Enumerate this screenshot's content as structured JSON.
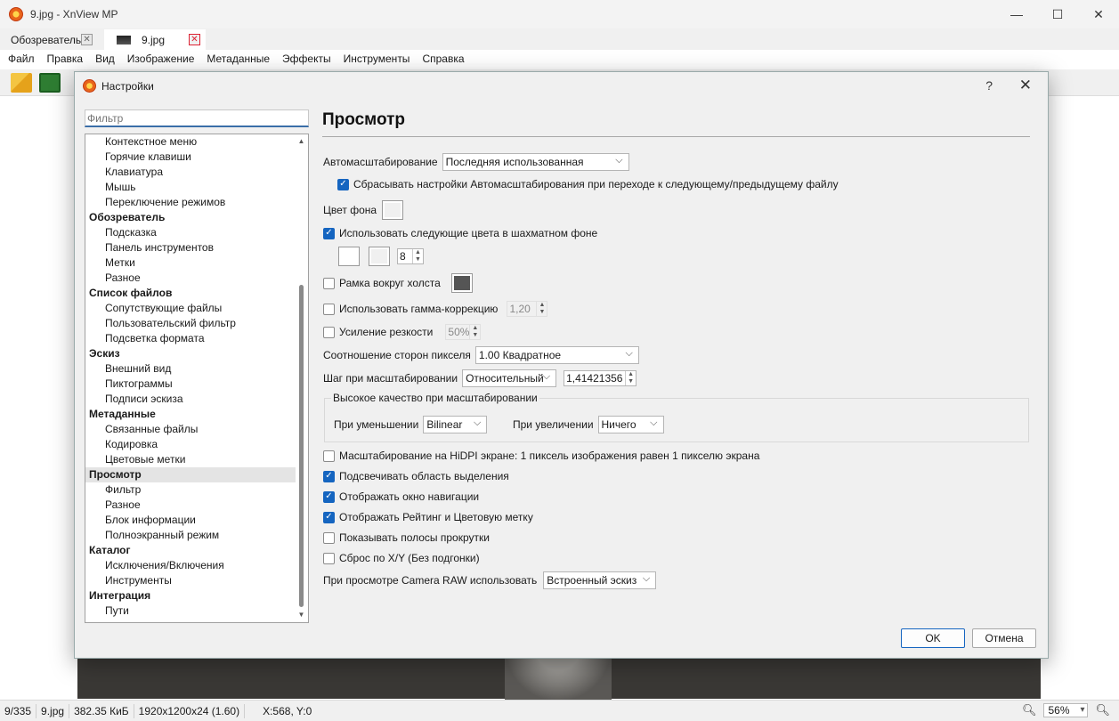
{
  "window": {
    "title": "9.jpg - XnView MP",
    "minimize": "—",
    "maximize": "☐",
    "close": "✕"
  },
  "tabs": [
    {
      "label": "Обозреватель",
      "close": "✕"
    },
    {
      "label": "9.jpg",
      "close": "✕"
    }
  ],
  "menu": [
    "Файл",
    "Правка",
    "Вид",
    "Изображение",
    "Метаданные",
    "Эффекты",
    "Инструменты",
    "Справка"
  ],
  "status": {
    "index": "9/335",
    "file": "9.jpg",
    "size": "382.35 КиБ",
    "dims": "1920x1200x24 (1.60)",
    "coords": "X:568, Y:0",
    "zoom": "56%"
  },
  "dialog": {
    "title": "Настройки",
    "help": "?",
    "close": "✕",
    "filter_placeholder": "Фильтр",
    "tree": [
      {
        "label": "Контекстное меню",
        "level": 1
      },
      {
        "label": "Горячие клавиши",
        "level": 1
      },
      {
        "label": "Клавиатура",
        "level": 1
      },
      {
        "label": "Мышь",
        "level": 1
      },
      {
        "label": "Переключение режимов",
        "level": 1
      },
      {
        "label": "Обозреватель",
        "level": 0
      },
      {
        "label": "Подсказка",
        "level": 1
      },
      {
        "label": "Панель инструментов",
        "level": 1
      },
      {
        "label": "Метки",
        "level": 1
      },
      {
        "label": "Разное",
        "level": 1
      },
      {
        "label": "Список файлов",
        "level": 0
      },
      {
        "label": "Сопутствующие файлы",
        "level": 1
      },
      {
        "label": "Пользовательский фильтр",
        "level": 1
      },
      {
        "label": "Подсветка формата",
        "level": 1
      },
      {
        "label": "Эскиз",
        "level": 0
      },
      {
        "label": "Внешний вид",
        "level": 1
      },
      {
        "label": "Пиктограммы",
        "level": 1
      },
      {
        "label": "Подписи эскиза",
        "level": 1
      },
      {
        "label": "Метаданные",
        "level": 0
      },
      {
        "label": "Связанные файлы",
        "level": 1
      },
      {
        "label": "Кодировка",
        "level": 1
      },
      {
        "label": "Цветовые метки",
        "level": 1
      },
      {
        "label": "Просмотр",
        "level": 0,
        "selected": true
      },
      {
        "label": "Фильтр",
        "level": 1
      },
      {
        "label": "Разное",
        "level": 1
      },
      {
        "label": "Блок информации",
        "level": 1
      },
      {
        "label": "Полноэкранный режим",
        "level": 1
      },
      {
        "label": "Каталог",
        "level": 0
      },
      {
        "label": "Исключения/Включения",
        "level": 1
      },
      {
        "label": "Инструменты",
        "level": 1
      },
      {
        "label": "Интеграция",
        "level": 0
      },
      {
        "label": "Пути",
        "level": 1
      }
    ],
    "page_title": "Просмотр",
    "autoscale": {
      "label": "Автомасштабирование",
      "value": "Последняя использованная"
    },
    "reset_autoscale": {
      "label": "Сбрасывать настройки Автомасштабирования при переходе к следующему/предыдущему файлу",
      "checked": true
    },
    "bg_color": {
      "label": "Цвет фона",
      "color": "#f0f0f0"
    },
    "checker": {
      "label": "Использовать следующие цвета в шахматном фоне",
      "checked": true,
      "color1": "#ffffff",
      "color2": "#f0f0f0",
      "size": "8"
    },
    "canvas_frame": {
      "label": "Рамка вокруг холста",
      "checked": false,
      "color": "#555555"
    },
    "gamma": {
      "label": "Использовать гамма-коррекцию",
      "checked": false,
      "value": "1,20"
    },
    "sharpen": {
      "label": "Усиление резкости",
      "checked": false,
      "value": "50%"
    },
    "pixel_ratio": {
      "label": "Соотношение сторон пикселя",
      "value": "1.00  Квадратное"
    },
    "zoom_step": {
      "label": "Шаг при масштабировании",
      "mode": "Относительный",
      "value": "1,41421356"
    },
    "hq_group": {
      "label": "Высокое качество при масштабировании",
      "down_label": "При уменьшении",
      "down_value": "Bilinear",
      "up_label": "При увеличении",
      "up_value": "Ничего"
    },
    "options": [
      {
        "label": "Масштабирование на HiDPI экране: 1 пиксель изображения равен 1 пикселю экрана",
        "checked": false
      },
      {
        "label": "Подсвечивать область выделения",
        "checked": true
      },
      {
        "label": "Отображать окно навигации",
        "checked": true
      },
      {
        "label": "Отображать Рейтинг и Цветовую метку",
        "checked": true
      },
      {
        "label": "Показывать полосы прокрутки",
        "checked": false
      },
      {
        "label": "Сброс по X/Y (Без подгонки)",
        "checked": false
      }
    ],
    "camera_raw": {
      "label": "При просмотре Camera RAW использовать",
      "value": "Встроенный эскиз"
    },
    "ok": "OK",
    "cancel": "Отмена"
  },
  "colors": {
    "accent": "#1565c0",
    "selection": "#e4e4e4"
  }
}
